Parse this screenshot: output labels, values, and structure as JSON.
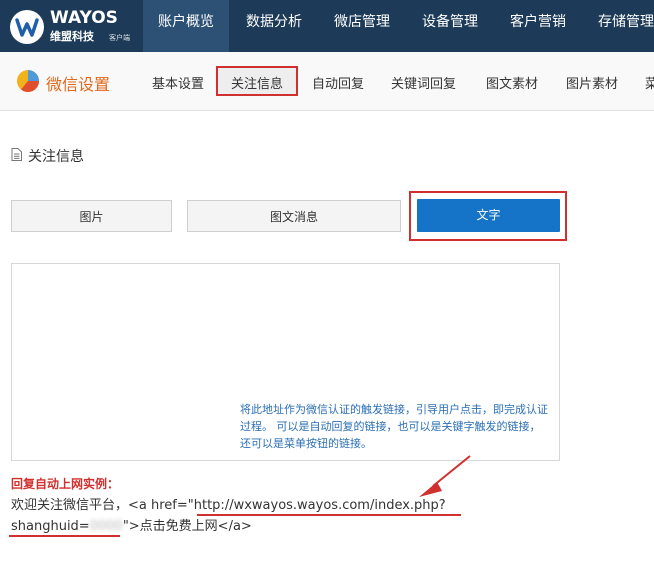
{
  "brand": {
    "name": "WAYOS",
    "sub": "维盟科技",
    "tag": "客户端"
  },
  "topnav": [
    {
      "label": "账户概览",
      "active": true
    },
    {
      "label": "数据分析",
      "active": false
    },
    {
      "label": "微店管理",
      "active": false
    },
    {
      "label": "设备管理",
      "active": false
    },
    {
      "label": "客户营销",
      "active": false
    },
    {
      "label": "存储管理",
      "active": false
    }
  ],
  "wechat": {
    "title": "微信设置",
    "tabs": [
      "基本设置",
      "关注信息",
      "自动回复",
      "关键词回复",
      "图文素材",
      "图片素材",
      "菜"
    ],
    "active_tab": "关注信息"
  },
  "section": {
    "title": "关注信息"
  },
  "msg_types": {
    "image": "图片",
    "news": "图文消息",
    "text": "文字",
    "selected": "文字"
  },
  "editor": {
    "note": "将此地址作为微信认证的触发链接，引导用户点击，即完成认证过程。 可以是自动回复的链接，也可以是关键字触发的链接，还可以是菜单按钮的链接。"
  },
  "example": {
    "title": "回复自动上网实例：",
    "line1_prefix": "欢迎关注微信平台，<a href=\"",
    "line1_url": "http://wxwayos.wayos.com/index.php?",
    "line2_param": "shanghuid=",
    "line2_blurred": "0000",
    "line2_suffix": "\">点击免费上网</a>"
  },
  "colors": {
    "topbar": "#1d3b58",
    "accent_orange": "#e26a1d",
    "highlight_red": "#d0302e",
    "primary_blue": "#1574c8",
    "note_blue": "#2b6fb4"
  }
}
